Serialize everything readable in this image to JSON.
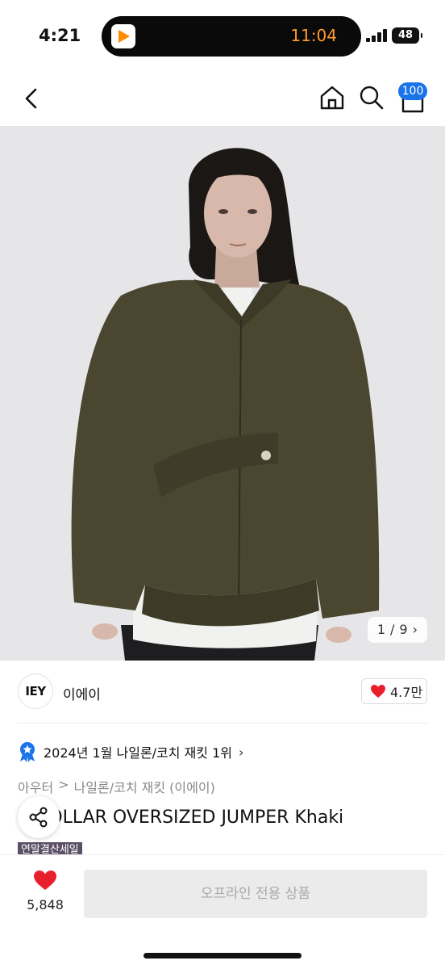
{
  "status_bar": {
    "time": "4:21",
    "island_timer": "11:04",
    "battery": "48"
  },
  "nav": {
    "cart_count": "100"
  },
  "gallery": {
    "current": "1",
    "separator": "/",
    "total": "9"
  },
  "brand": {
    "logo_text": "IEY",
    "name": "이에이",
    "likes": "4.7만"
  },
  "ranking": {
    "text": "2024년 1월 나일론/코치 재킷 1위"
  },
  "breadcrumb": {
    "category": "아우터",
    "separator": ">",
    "subcategory": "나일론/코치 재킷 (이에이)"
  },
  "product": {
    "title": "E COLLAR OVERSIZED JUMPER Khaki",
    "sale_badge": "연말결산세일"
  },
  "bottom": {
    "wish_count": "5,848",
    "buy_label": "오프라인 전용 상품"
  },
  "colors": {
    "accent": "#1a73e8",
    "heart": "#e8202e",
    "sale_badge": "#5b4f66",
    "jacket": "#4a4630"
  }
}
